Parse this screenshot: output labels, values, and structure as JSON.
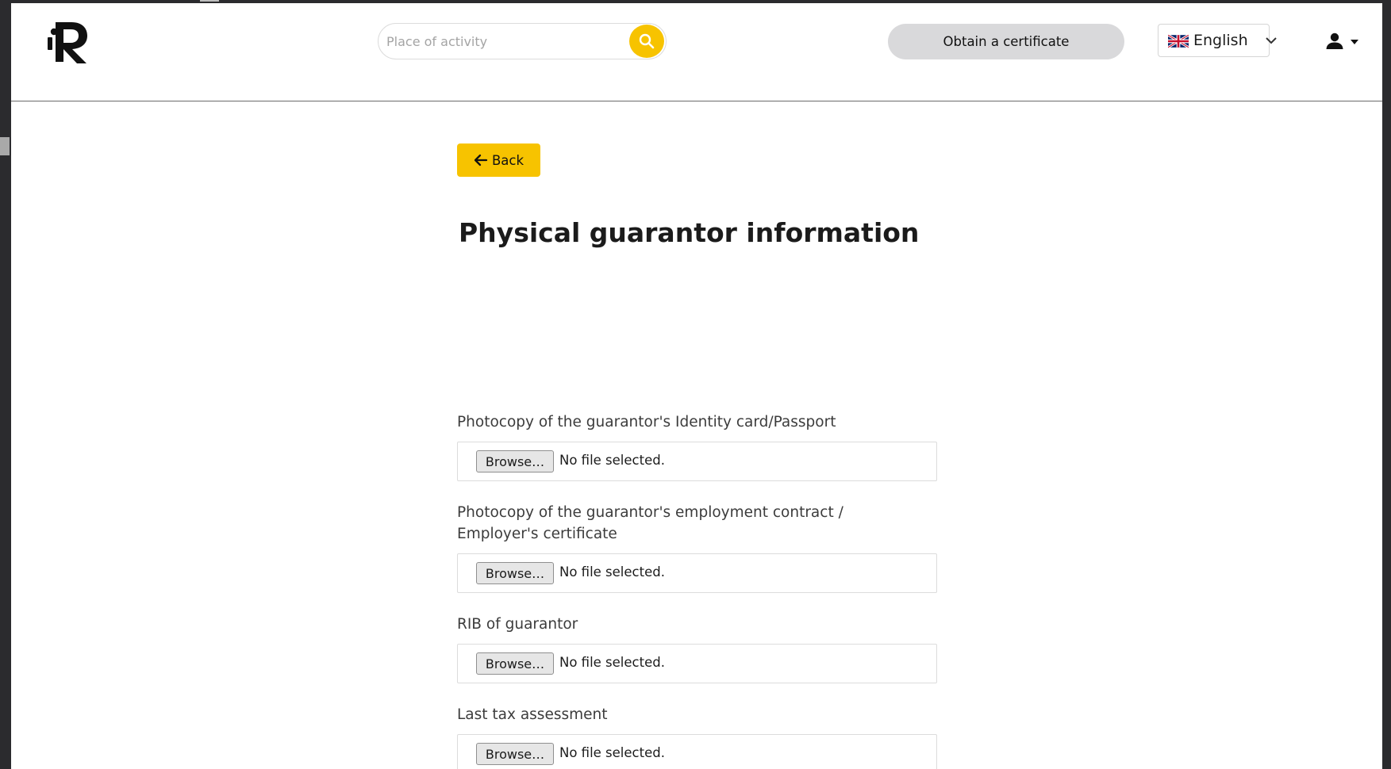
{
  "header": {
    "search": {
      "placeholder": "Place of activity"
    },
    "certificate_button": "Obtain a certificate",
    "language": {
      "selected": "English",
      "flag": "uk-flag-icon"
    }
  },
  "main": {
    "back_label": "Back",
    "title": "Physical guarantor information",
    "uploads": [
      {
        "label": "Photocopy of the guarantor's Identity card/Passport",
        "button": "Browse…",
        "status": "No file selected."
      },
      {
        "label_line1": "Photocopy of the guarantor's employment contract /",
        "label_line2": "Employer's certificate",
        "button": "Browse…",
        "status": "No file selected."
      },
      {
        "label": "RIB of guarantor",
        "button": "Browse…",
        "status": "No file selected."
      },
      {
        "label": "Last tax assessment",
        "button": "Browse…",
        "status": "No file selected."
      }
    ]
  },
  "colors": {
    "accent": "#f7c300",
    "certificate_bg": "#d9d9db",
    "text": "#1b1b1b"
  }
}
